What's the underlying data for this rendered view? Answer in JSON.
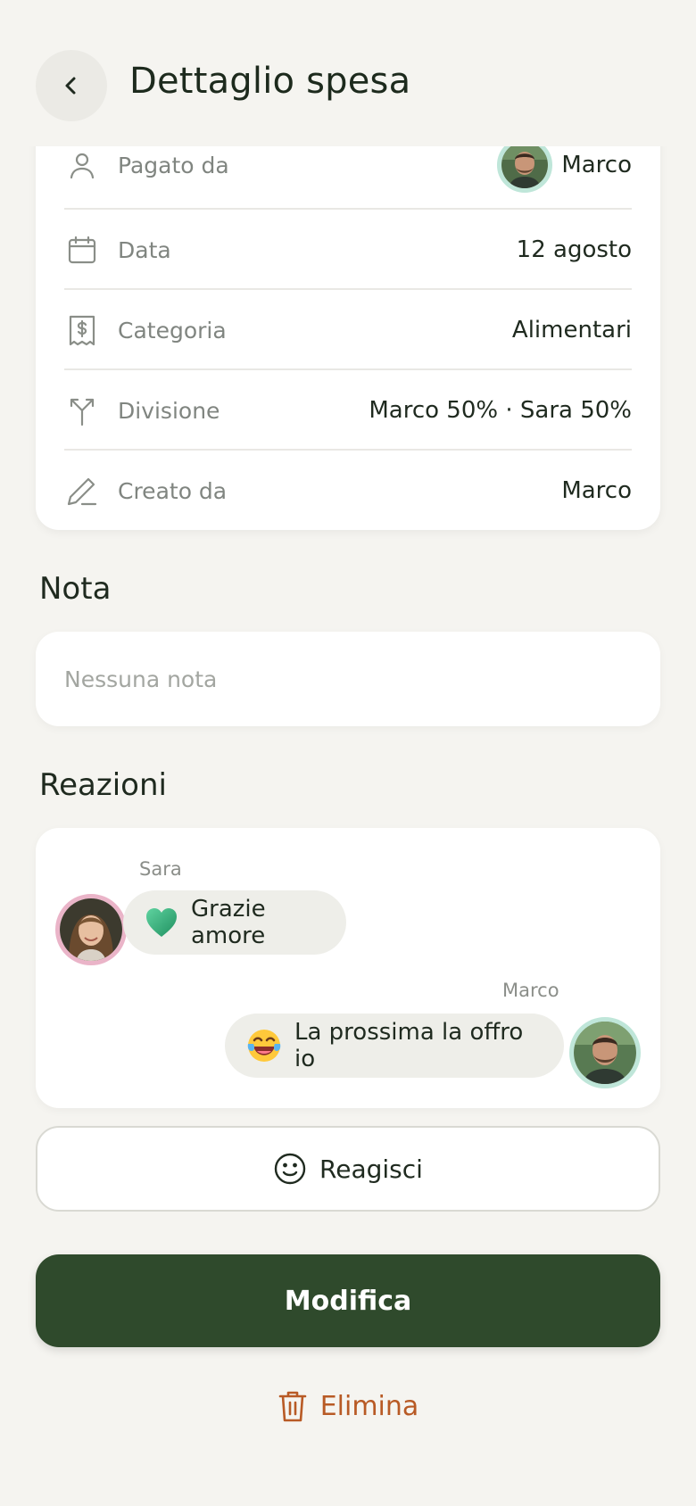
{
  "header": {
    "title": "Dettaglio spesa",
    "back_icon": "chevron-left-icon"
  },
  "details": {
    "rows": [
      {
        "icon": "user-icon",
        "label": "Pagato da",
        "value": "Marco",
        "avatar": "marco"
      },
      {
        "icon": "calendar-icon",
        "label": "Data",
        "value": "12 agosto"
      },
      {
        "icon": "receipt-icon",
        "label": "Categoria",
        "value": "Alimentari"
      },
      {
        "icon": "split-icon",
        "label": "Divisione",
        "value": "Marco 50% · Sara 50%"
      },
      {
        "icon": "pencil-icon",
        "label": "Creato da",
        "value": "Marco"
      }
    ]
  },
  "note": {
    "title": "Nota",
    "text": "Nessuna nota"
  },
  "reactions": {
    "title": "Reazioni",
    "items": [
      {
        "sender": "Sara",
        "emoji": "green-heart",
        "text": "Grazie amore",
        "side": "left"
      },
      {
        "sender": "Marco",
        "emoji": "laughing-tears",
        "text": "La prossima la offro io",
        "side": "right"
      }
    ],
    "react_label": "Reagisci"
  },
  "actions": {
    "edit_label": "Modifica",
    "delete_label": "Elimina"
  },
  "colors": {
    "background": "#f5f4f0",
    "primary": "#2f4a2c",
    "danger": "#b85a25",
    "marco_ring": "#bfe6d9",
    "sara_ring": "#eab4c8"
  }
}
